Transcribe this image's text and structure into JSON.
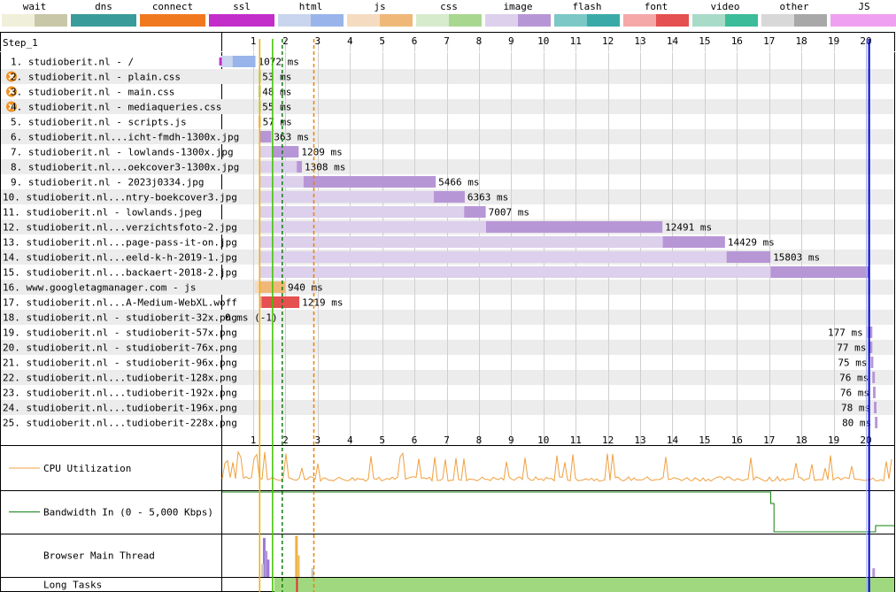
{
  "step": "Step_1",
  "legend": [
    {
      "name": "wait",
      "c1": "#f0f0da",
      "c2": "#c8c8a8"
    },
    {
      "name": "dns",
      "c1": "#3a9c9a",
      "c2": "#3a9c9a"
    },
    {
      "name": "connect",
      "c1": "#f0791f",
      "c2": "#f0791f"
    },
    {
      "name": "ssl",
      "c1": "#c32ecb",
      "c2": "#c32ecb"
    },
    {
      "name": "html",
      "c1": "#c9d5ee",
      "c2": "#98b4ea"
    },
    {
      "name": "js",
      "c1": "#f5dcc0",
      "c2": "#f0b878"
    },
    {
      "name": "css",
      "c1": "#d6ebcc",
      "c2": "#a8d890"
    },
    {
      "name": "image",
      "c1": "#dcd0ec",
      "c2": "#b796d6"
    },
    {
      "name": "flash",
      "c1": "#7cc8c6",
      "c2": "#3aaaa8"
    },
    {
      "name": "font",
      "c1": "#f4a8a8",
      "c2": "#e55050"
    },
    {
      "name": "video",
      "c1": "#a8dcc8",
      "c2": "#3cbc98"
    },
    {
      "name": "other",
      "c1": "#d8d8d8",
      "c2": "#a8a8a8"
    },
    {
      "name": "JS Execution",
      "c1": "#f0a0f0",
      "c2": "#f0a0f0"
    }
  ],
  "chart_data": {
    "type": "waterfall",
    "x_unit": "seconds",
    "x_ticks": [
      1,
      2,
      3,
      4,
      5,
      6,
      7,
      8,
      9,
      10,
      11,
      12,
      13,
      14,
      15,
      16,
      17,
      18,
      19,
      20
    ],
    "requests": [
      {
        "label": "1. studioberit.nl - /",
        "type": "html",
        "start": 0.0,
        "ttfb": 0.36,
        "end": 1.07,
        "time_label": "1072 ms",
        "warn": false
      },
      {
        "label": "2. studioberit.nl - plain.css",
        "type": "css",
        "start": 1.15,
        "ttfb": 1.18,
        "end": 1.2,
        "time_label": "53 ms",
        "warn": true
      },
      {
        "label": "3. studioberit.nl - main.css",
        "type": "css",
        "start": 1.15,
        "ttfb": 1.18,
        "end": 1.2,
        "time_label": "48 ms",
        "warn": true
      },
      {
        "label": "4. studioberit.nl - mediaqueries.css",
        "type": "css",
        "start": 1.15,
        "ttfb": 1.18,
        "end": 1.2,
        "time_label": "55 ms",
        "warn": true
      },
      {
        "label": "5. studioberit.nl - scripts.js",
        "type": "js",
        "start": 1.15,
        "ttfb": 1.18,
        "end": 1.21,
        "time_label": "57 ms",
        "warn": false
      },
      {
        "label": "6. studioberit.nl...icht-fmdh-1300x.jpg",
        "type": "image",
        "start": 1.2,
        "ttfb": 1.2,
        "end": 1.56,
        "time_label": "363 ms",
        "warn": false
      },
      {
        "label": "7. studioberit.nl - lowlands-1300x.jpg",
        "type": "image",
        "start": 1.2,
        "ttfb": 1.6,
        "end": 2.41,
        "time_label": "1209 ms",
        "warn": false
      },
      {
        "label": "8. studioberit.nl...oekcover3-1300x.jpg",
        "type": "image",
        "start": 1.2,
        "ttfb": 2.35,
        "end": 2.51,
        "time_label": "1308 ms",
        "warn": false
      },
      {
        "label": "9. studioberit.nl - 2023j0334.jpg",
        "type": "image",
        "start": 1.2,
        "ttfb": 2.56,
        "end": 6.66,
        "time_label": "5466 ms",
        "warn": false
      },
      {
        "label": "10. studioberit.nl...ntry-boekcover3.jpg",
        "type": "image",
        "start": 1.2,
        "ttfb": 6.6,
        "end": 7.56,
        "time_label": "6363 ms",
        "warn": false
      },
      {
        "label": "11. studioberit.nl - lowlands.jpeg",
        "type": "image",
        "start": 1.2,
        "ttfb": 7.54,
        "end": 8.21,
        "time_label": "7007 ms",
        "warn": false
      },
      {
        "label": "12. studioberit.nl...verzichtsfoto-2.jpg",
        "type": "image",
        "start": 1.2,
        "ttfb": 8.22,
        "end": 13.69,
        "time_label": "12491 ms",
        "warn": false
      },
      {
        "label": "13. studioberit.nl...page-pass-it-on.jpg",
        "type": "image",
        "start": 1.2,
        "ttfb": 13.7,
        "end": 15.63,
        "time_label": "14429 ms",
        "warn": false
      },
      {
        "label": "14. studioberit.nl...eeld-k-h-2019-1.jpg",
        "type": "image",
        "start": 1.2,
        "ttfb": 15.68,
        "end": 17.04,
        "time_label": "15803 ms",
        "warn": false
      },
      {
        "label": "15. studioberit.nl...backaert-2018-2.jpg",
        "type": "image",
        "start": 1.2,
        "ttfb": 17.04,
        "end": 20.1,
        "time_label": "",
        "warn": false
      },
      {
        "label": "16. www.googletagmanager.com - js",
        "type": "js",
        "start": 1.05,
        "ttfb": 1.2,
        "end": 1.99,
        "time_label": "940 ms",
        "warn": false
      },
      {
        "label": "17. studioberit.nl...A-Medium-WebXL.woff",
        "type": "font",
        "start": 1.2,
        "ttfb": 1.26,
        "end": 2.43,
        "time_label": "1219 ms",
        "warn": false
      },
      {
        "label": "18. studioberit.nl - studioberit-32x.png",
        "type": "image",
        "start": null,
        "ttfb": null,
        "end": null,
        "time_label": "0 ms (-1)",
        "warn": false
      },
      {
        "label": "19. studioberit.nl - studioberit-57x.png",
        "type": "image",
        "start": 20.02,
        "ttfb": 20.08,
        "end": 20.2,
        "time_label": "177 ms",
        "warn": false
      },
      {
        "label": "20. studioberit.nl - studioberit-76x.png",
        "type": "image",
        "start": 20.12,
        "ttfb": 20.12,
        "end": 20.2,
        "time_label": "77 ms",
        "warn": false
      },
      {
        "label": "21. studioberit.nl - studioberit-96x.png",
        "type": "image",
        "start": 20.15,
        "ttfb": 20.15,
        "end": 20.23,
        "time_label": "75 ms",
        "warn": false
      },
      {
        "label": "22. studioberit.nl...tudioberit-128x.png",
        "type": "image",
        "start": 20.2,
        "ttfb": 20.2,
        "end": 20.28,
        "time_label": "76 ms",
        "warn": false
      },
      {
        "label": "23. studioberit.nl...tudioberit-192x.png",
        "type": "image",
        "start": 20.22,
        "ttfb": 20.22,
        "end": 20.3,
        "time_label": "76 ms",
        "warn": false
      },
      {
        "label": "24. studioberit.nl...tudioberit-196x.png",
        "type": "image",
        "start": 20.25,
        "ttfb": 20.25,
        "end": 20.33,
        "time_label": "78 ms",
        "warn": false
      },
      {
        "label": "25. studioberit.nl...tudioberit-228x.png",
        "type": "image",
        "start": 20.28,
        "ttfb": 20.28,
        "end": 20.36,
        "time_label": "80 ms",
        "warn": false
      }
    ],
    "markers": [
      {
        "t": 1.2,
        "color": "#f0b000",
        "style": "solid"
      },
      {
        "t": 1.6,
        "color": "#40c000",
        "style": "solid"
      },
      {
        "t": 1.9,
        "color": "#108010",
        "style": "dashed"
      },
      {
        "t": 2.88,
        "color": "#f08000",
        "style": "dashed"
      },
      {
        "t": 20.1,
        "color": "#0000d0",
        "style": "solid"
      }
    ],
    "subcharts": [
      {
        "label": "CPU Utilization",
        "color": "#f0a040"
      },
      {
        "label": "Bandwidth In (0 - 5,000 Kbps)",
        "color": "#108010"
      },
      {
        "label": "Browser Main Thread",
        "color": "#b796d6"
      },
      {
        "label": "Long Tasks",
        "color": "#a0d880"
      }
    ]
  }
}
